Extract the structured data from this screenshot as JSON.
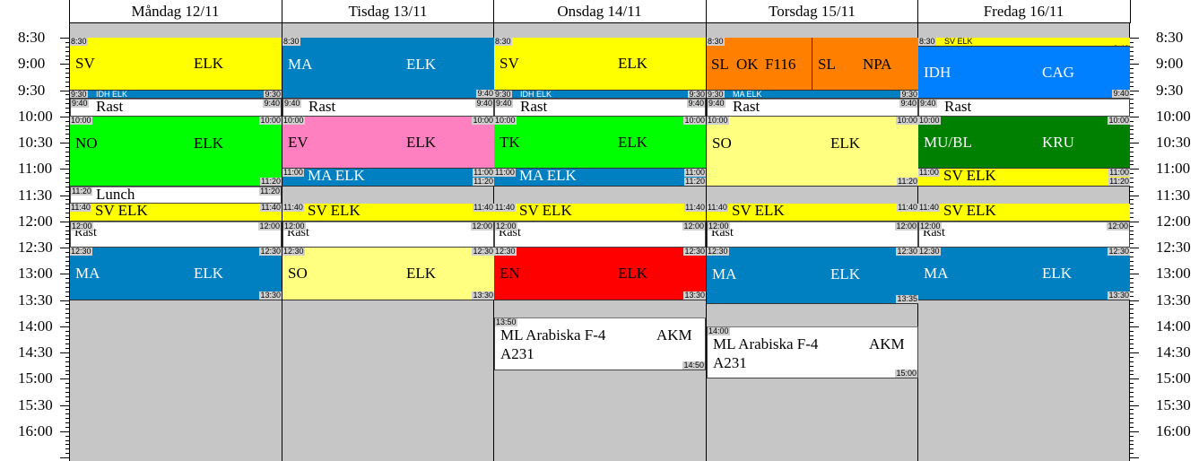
{
  "days": [
    {
      "label": "Måndag 12/11"
    },
    {
      "label": "Tisdag 13/11"
    },
    {
      "label": "Onsdag 14/11"
    },
    {
      "label": "Torsdag 15/11"
    },
    {
      "label": "Fredag 16/11"
    }
  ],
  "time_labels": [
    "8:30",
    "9:00",
    "9:30",
    "10:00",
    "10:30",
    "11:00",
    "11:30",
    "12:00",
    "12:30",
    "13:00",
    "13:30",
    "14:00",
    "14:30",
    "15:00",
    "15:30",
    "16:00"
  ],
  "colors": {
    "yellow": "#ffff00",
    "blue": "#0080c0",
    "brightblue": "#0080ff",
    "green": "#00ff00",
    "pink": "#ff80c0",
    "lightyellow": "#ffff80",
    "red": "#ff0000",
    "orange": "#ff8000",
    "darkgreen": "#008000",
    "white": "#ffffff",
    "background": "#c6c6c6"
  },
  "events": [
    {
      "day": 0,
      "start": "8:30",
      "end": "9:30",
      "color": "yellow",
      "texts": [
        "SV",
        "ELK"
      ],
      "start_label": "8:30",
      "end_label": ""
    },
    {
      "day": 0,
      "start": "9:30",
      "end": "9:40",
      "color": "blue",
      "small": "IDH ELK",
      "start_label": "9:30",
      "end_label": "9:30",
      "end_label2": "9:40",
      "start_label2": "9:40"
    },
    {
      "day": 0,
      "start": "9:40",
      "end": "10:00",
      "color": "white",
      "line": "Rast",
      "start_label": "9:40",
      "end_label": "9:40"
    },
    {
      "day": 0,
      "start": "10:00",
      "end": "11:20",
      "color": "green",
      "texts": [
        "NO",
        "ELK"
      ],
      "start_label": "10:00",
      "end_label": "10:00",
      "bottom_label": "11:20"
    },
    {
      "day": 0,
      "start": "11:20",
      "end": "11:40",
      "color": "white",
      "line": "Lunch",
      "start_label": "11:20",
      "end_label": "11:20"
    },
    {
      "day": 0,
      "start": "11:40",
      "end": "12:00",
      "color": "yellow",
      "line": "SV ELK",
      "start_label": "11:40",
      "end_label": "11:40"
    },
    {
      "day": 0,
      "start": "12:00",
      "end": "12:30",
      "color": "white",
      "line": "Rast",
      "start_label": "12:00",
      "end_label": "12:00"
    },
    {
      "day": 0,
      "start": "12:30",
      "end": "13:30",
      "color": "blue",
      "texts": [
        "MA",
        "ELK"
      ],
      "start_label": "12:30",
      "end_label": "12:30",
      "bottom_label": "13:30"
    },
    {
      "day": 1,
      "start": "8:30",
      "end": "9:40",
      "color": "blue",
      "texts": [
        "MA",
        "ELK"
      ],
      "start_label": "8:30",
      "bottom_label": "9:40"
    },
    {
      "day": 1,
      "start": "9:40",
      "end": "10:00",
      "color": "white",
      "line": "Rast",
      "start_label": "9:40",
      "end_label": "9:40"
    },
    {
      "day": 1,
      "start": "10:00",
      "end": "11:00",
      "color": "pink",
      "texts": [
        "EV",
        "ELK"
      ],
      "start_label": "10:00",
      "end_label": "10:00"
    },
    {
      "day": 1,
      "start": "11:00",
      "end": "11:20",
      "color": "blue",
      "line": "MA ELK",
      "start_label": "11:00",
      "end_label": "11:00",
      "bottom_label": "11:20"
    },
    {
      "day": 1,
      "start": "11:40",
      "end": "12:00",
      "color": "yellow",
      "line": "SV ELK",
      "start_label": "11:40",
      "end_label": "11:40"
    },
    {
      "day": 1,
      "start": "12:00",
      "end": "12:30",
      "color": "white",
      "line": "Rast",
      "start_label": "12:00",
      "end_label": "12:00"
    },
    {
      "day": 1,
      "start": "12:30",
      "end": "13:30",
      "color": "lightyellow",
      "texts": [
        "SO",
        "ELK"
      ],
      "start_label": "12:30",
      "end_label": "12:30",
      "bottom_label": "13:30"
    },
    {
      "day": 2,
      "start": "8:30",
      "end": "9:30",
      "color": "yellow",
      "texts": [
        "SV",
        "ELK"
      ],
      "start_label": "8:30"
    },
    {
      "day": 2,
      "start": "9:30",
      "end": "9:40",
      "color": "blue",
      "small": "IDH ELK",
      "start_label": "9:30",
      "end_label": "9:30",
      "end_label2": "9:40",
      "start_label2": "9:40"
    },
    {
      "day": 2,
      "start": "9:40",
      "end": "10:00",
      "color": "white",
      "line": "Rast",
      "start_label": "9:40",
      "end_label": "9:40"
    },
    {
      "day": 2,
      "start": "10:00",
      "end": "11:00",
      "color": "green",
      "texts": [
        "TK",
        "ELK"
      ],
      "start_label": "10:00",
      "end_label": "10:00"
    },
    {
      "day": 2,
      "start": "11:00",
      "end": "11:20",
      "color": "blue",
      "line": "MA ELK",
      "start_label": "11:00",
      "end_label": "11:00",
      "bottom_label": "11:20"
    },
    {
      "day": 2,
      "start": "11:40",
      "end": "12:00",
      "color": "yellow",
      "line": "SV ELK",
      "start_label": "11:40",
      "end_label": "11:40"
    },
    {
      "day": 2,
      "start": "12:00",
      "end": "12:30",
      "color": "white",
      "line": "Rast",
      "start_label": "12:00",
      "end_label": "12:00"
    },
    {
      "day": 2,
      "start": "12:30",
      "end": "13:30",
      "color": "red",
      "texts": [
        "EN",
        "ELK"
      ],
      "start_label": "12:30",
      "end_label": "12:30",
      "bottom_label": "13:30"
    },
    {
      "day": 2,
      "start": "13:50",
      "end": "14:50",
      "color": "white",
      "multi": [
        "ML Arabiska F-4",
        "AKM",
        "A231"
      ],
      "start_label": "13:50",
      "bottom_label": "14:50"
    },
    {
      "day": 3,
      "start": "8:30",
      "end": "9:30",
      "color": "orange",
      "split": [
        [
          "SL",
          "OK",
          "F116"
        ],
        [
          "SL",
          "NPA"
        ]
      ],
      "start_label": "8:30"
    },
    {
      "day": 3,
      "start": "9:30",
      "end": "9:40",
      "color": "blue",
      "small": "MA ELK",
      "start_label": "9:30",
      "end_label": "9:30",
      "end_label2": "9:40",
      "start_label2": "9:40"
    },
    {
      "day": 3,
      "start": "9:40",
      "end": "10:00",
      "color": "white",
      "line": "Rast",
      "start_label": "9:40",
      "end_label": "9:40"
    },
    {
      "day": 3,
      "start": "10:00",
      "end": "11:20",
      "color": "lightyellow",
      "texts": [
        "SO",
        "ELK"
      ],
      "start_label": "10:00",
      "end_label": "10:00",
      "bottom_label": "11:20"
    },
    {
      "day": 3,
      "start": "11:40",
      "end": "12:00",
      "color": "yellow",
      "line": "SV ELK",
      "start_label": "11:40",
      "end_label": "11:40"
    },
    {
      "day": 3,
      "start": "12:00",
      "end": "12:30",
      "color": "white",
      "line": "Rast",
      "start_label": "12:00",
      "end_label": "12:00"
    },
    {
      "day": 3,
      "start": "12:30",
      "end": "13:35",
      "color": "blue",
      "texts": [
        "MA",
        "ELK"
      ],
      "start_label": "12:30",
      "end_label": "12:30",
      "bottom_label": "13:35"
    },
    {
      "day": 3,
      "start": "14:00",
      "end": "15:00",
      "color": "white",
      "multi": [
        "ML Arabiska F-4",
        "AKM",
        "A231"
      ],
      "start_label": "14:00",
      "bottom_label": "15:00"
    },
    {
      "day": 4,
      "start": "8:30",
      "end": "8:40",
      "color": "yellow",
      "small": "SV ELK",
      "start_label": "8:30",
      "start_label2": "8:40",
      "end_label2": "8:40"
    },
    {
      "day": 4,
      "start": "8:40",
      "end": "9:40",
      "color": "brightblue",
      "texts": [
        "IDH",
        "CAG"
      ],
      "bottom_label": "9:40"
    },
    {
      "day": 4,
      "start": "9:40",
      "end": "10:00",
      "color": "white",
      "line": "Rast",
      "start_label": "9:40"
    },
    {
      "day": 4,
      "start": "10:00",
      "end": "11:00",
      "color": "darkgreen",
      "texts": [
        "MU/BL",
        "KRU"
      ],
      "start_label": "10:00",
      "end_label": "10:00"
    },
    {
      "day": 4,
      "start": "11:00",
      "end": "11:20",
      "color": "yellow",
      "line": "SV ELK",
      "start_label": "11:00",
      "end_label": "11:00",
      "bottom_label": "11:20"
    },
    {
      "day": 4,
      "start": "11:40",
      "end": "12:00",
      "color": "yellow",
      "line": "SV ELK",
      "start_label": "11:40"
    },
    {
      "day": 4,
      "start": "12:00",
      "end": "12:30",
      "color": "white",
      "line": "Rast",
      "start_label": "12:00",
      "end_label": "12:00"
    },
    {
      "day": 4,
      "start": "12:30",
      "end": "13:30",
      "color": "blue",
      "texts": [
        "MA",
        "ELK"
      ],
      "start_label": "12:30",
      "end_label": "12:30",
      "bottom_label": "13:30"
    }
  ]
}
